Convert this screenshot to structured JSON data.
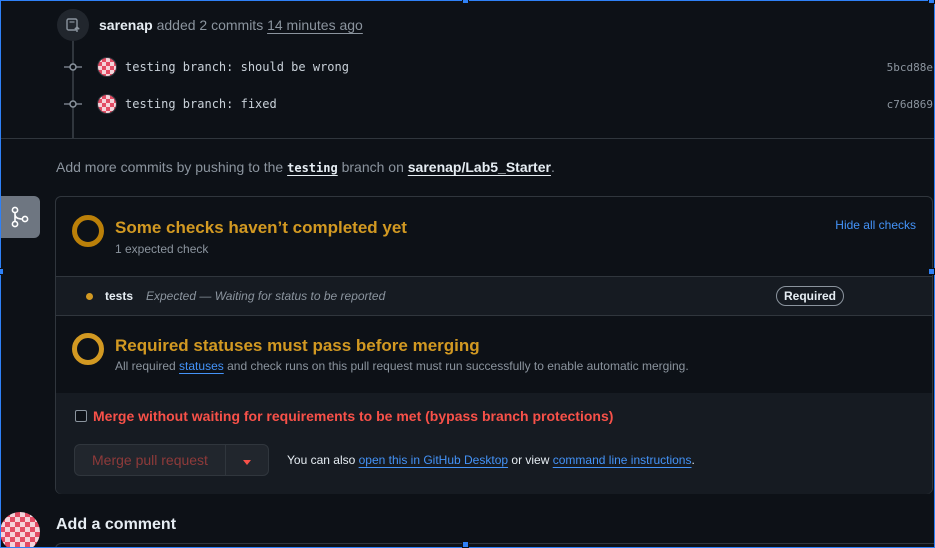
{
  "timeline": {
    "author": "sarenap",
    "action": "added 2 commits",
    "time": "14 minutes ago",
    "commits": [
      {
        "message": "testing branch: should be wrong",
        "sha": "5bcd88e"
      },
      {
        "message": "testing branch: fixed",
        "sha": "c76d869"
      }
    ]
  },
  "hint": {
    "prefix": "Add more commits by pushing to the",
    "branch": "testing",
    "middle": "branch on",
    "repo": "sarenap/Lab5_Starter",
    "suffix": "."
  },
  "checks": {
    "title": "Some checks haven’t completed yet",
    "subtitle": "1 expected check",
    "hide_link": "Hide all checks",
    "items": [
      {
        "name": "tests",
        "description": "Expected — Waiting for status to be reported",
        "badge": "Required"
      }
    ]
  },
  "required": {
    "title": "Required statuses must pass before merging",
    "text_before": "All required",
    "link": "statuses",
    "text_after": "and check runs on this pull request must run successfully to enable automatic merging."
  },
  "bypass": {
    "label": "Merge without waiting for requirements to be met (bypass branch protections)",
    "checked": false
  },
  "merge": {
    "button_label": "Merge pull request",
    "also_prefix": "You can also",
    "desktop_link": "open this in GitHub Desktop",
    "or_view": "or view",
    "cli_link": "command line instructions",
    "suffix": "."
  },
  "comment": {
    "title": "Add a comment"
  },
  "colors": {
    "pending": "#d29922",
    "danger": "#f85149",
    "link": "#4493f8"
  }
}
